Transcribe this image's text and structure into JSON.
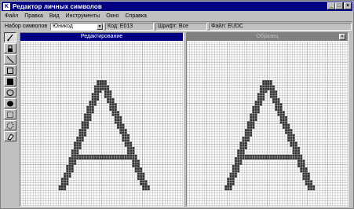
{
  "window": {
    "title": "Редактор личных символов",
    "app_icon": "K",
    "controls": [
      "minimize-icon",
      "maximize-icon",
      "close-icon"
    ]
  },
  "menu": [
    {
      "label": "Файл"
    },
    {
      "label": "Правка"
    },
    {
      "label": "Вид"
    },
    {
      "label": "Инструменты"
    },
    {
      "label": "Окно"
    },
    {
      "label": "Справка"
    }
  ],
  "info": {
    "charset_label": "Набор символов",
    "charset_value": "Юникод",
    "code": "Код: E013",
    "font": "Шрифт: Все",
    "file": "Файл: EUDC"
  },
  "tools": [
    "pencil-icon",
    "brush-icon",
    "line-icon",
    "hollow-rectangle-icon",
    "filled-rectangle-icon",
    "hollow-ellipse-icon",
    "filled-ellipse-icon",
    "rectangular-selection-icon",
    "freeform-selection-icon",
    "eraser-icon"
  ],
  "panes": {
    "edit": {
      "header": "Редактирование",
      "header_bg": "#000080",
      "header_fg": "#ffffff"
    },
    "reference": {
      "header": "Образец",
      "header_bg": "#808080",
      "header_fg": "#c0c0c0"
    }
  },
  "colors": {
    "glyph": "#333333",
    "grid": "#b0b0b0",
    "grid_major": "#808080",
    "title": "#000080"
  }
}
